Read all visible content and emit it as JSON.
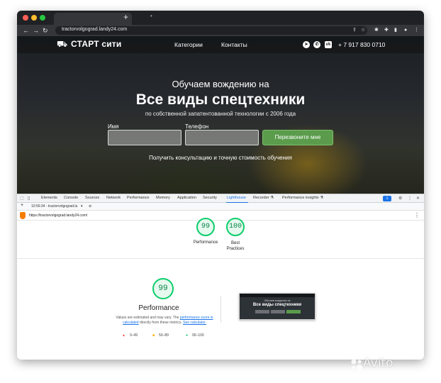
{
  "browser": {
    "tab_title": "",
    "url": "tractorvolgograd.landy24.com",
    "traffic_colors": [
      "#ff5f57",
      "#febc2e",
      "#28c840"
    ]
  },
  "site": {
    "logo_text": "СТАРТ сити",
    "nav": [
      "Категории",
      "Контакты"
    ],
    "phone": "+ 7 917 830 0710",
    "hero_subtitle": "Обучаем вождению на",
    "hero_title": "Все виды спецтехники",
    "hero_line": "по собственной запатентованной технологии с 2006 года",
    "form": {
      "name_label": "Имя",
      "phone_label": "Телефон",
      "button": "Перезвоните мне"
    },
    "hero_note": "Получить консультацию и точную стоимость обучения",
    "accent": "#5a9c4b"
  },
  "devtools": {
    "tabs": [
      "Elements",
      "Console",
      "Sources",
      "Network",
      "Performance",
      "Memory",
      "Application",
      "Security",
      "Lighthouse",
      "Recorder ⚗",
      "Performance insights ⚗"
    ],
    "active_tab": "Lighthouse",
    "badge": "1",
    "lighthouse_run": "10:56:34 - tractorvolgograd.la",
    "report_url": "https://tractorvolgograd.landy24.com/"
  },
  "report": {
    "scores": [
      {
        "value": "99",
        "label": "Performance"
      },
      {
        "value": "100",
        "label": "Best Practices"
      }
    ],
    "performance": {
      "score": "99",
      "title": "Performance",
      "desc_pre": "Values are estimated and may vary. The ",
      "link1": "performance score is calculated",
      "desc_mid": " directly from these metrics. ",
      "link2": "See calculator."
    },
    "legend": [
      {
        "mark": "▲",
        "range": "0–49",
        "color": "#ff4e42"
      },
      {
        "mark": "■",
        "range": "50–89",
        "color": "#ffa400"
      },
      {
        "mark": "●",
        "range": "90–100",
        "color": "#0cce6b"
      }
    ],
    "thumbnail": {
      "subtitle": "Обучаем вождению на",
      "title": "Все виды спецтехники"
    }
  },
  "watermark": "Avito"
}
